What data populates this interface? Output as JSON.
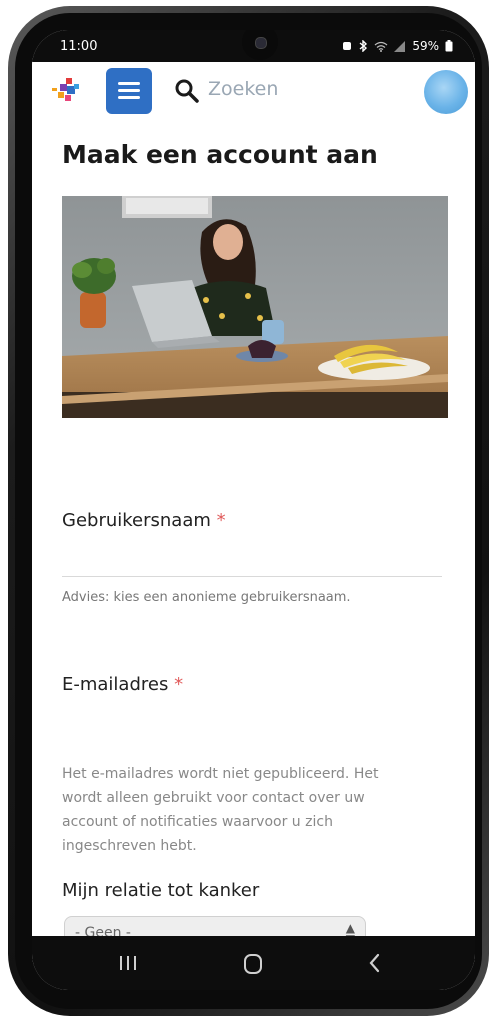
{
  "status_bar": {
    "time": "11:00",
    "battery": "59%"
  },
  "header": {
    "search_placeholder": "Zoeken"
  },
  "page": {
    "title": "Maak een account aan"
  },
  "form": {
    "username": {
      "label": "Gebruikersnaam",
      "required_marker": "*",
      "value": "",
      "hint": "Advies: kies een anonieme gebruikersnaam."
    },
    "email": {
      "label": "E-mailadres",
      "required_marker": "*",
      "value": "",
      "hint_lines": [
        "Het e-mailadres wordt niet gepubliceerd. Het",
        "wordt alleen gebruikt voor contact over uw",
        "account of notificaties waarvoor u zich",
        "ingeschreven hebt."
      ]
    },
    "relation": {
      "label": "Mijn relatie tot kanker",
      "selected": "- Geen -"
    }
  },
  "colors": {
    "menu_button": "#2f6fc4",
    "required": "#e05a5a",
    "avatar": "#6ab3e8"
  },
  "icons": {
    "menu": "hamburger-icon",
    "search": "search-icon",
    "avatar": "user-avatar-icon"
  }
}
